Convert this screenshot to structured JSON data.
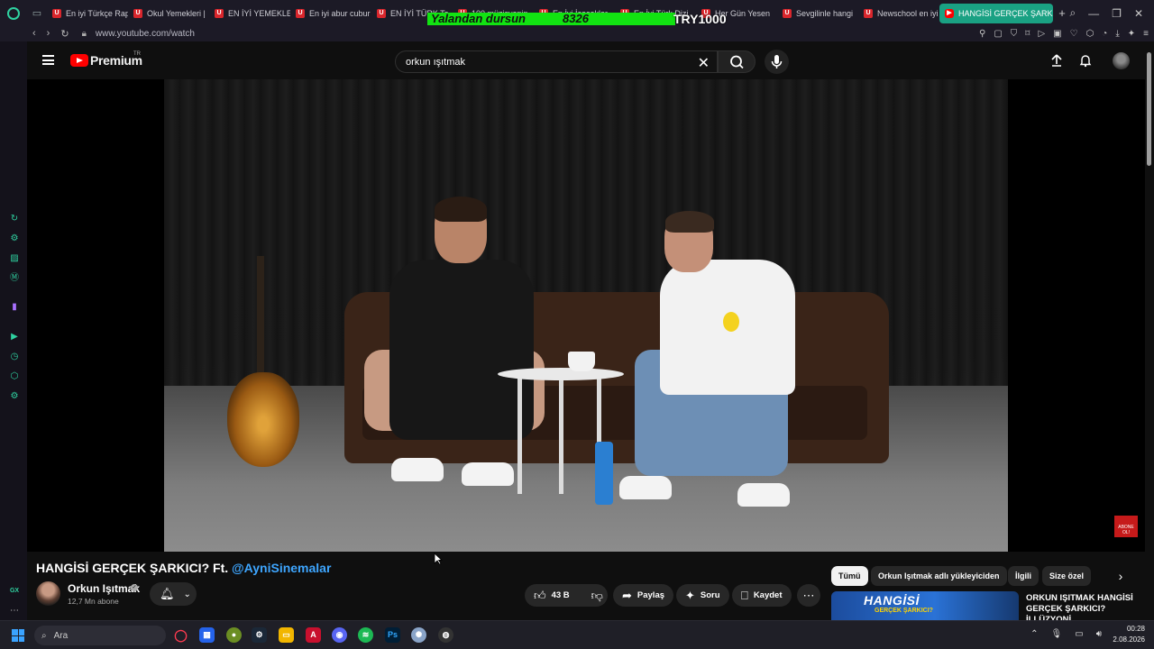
{
  "browser": {
    "tabs": [
      {
        "label": "En iyi Türkçe Rap"
      },
      {
        "label": "Okul Yemekleri |"
      },
      {
        "label": "EN İYİ YEMEKLER"
      },
      {
        "label": "En iyi abur cubur"
      },
      {
        "label": "EN İYİ TÜRK Ta"
      },
      {
        "label": "100 müzisyenin"
      },
      {
        "label": "En İyi İçecekler"
      },
      {
        "label": "En İyi Türk Dizi"
      },
      {
        "label": "Her Gün Yesen"
      },
      {
        "label": "Sevgilinle hangi"
      },
      {
        "label": "Newschool en iyi"
      },
      {
        "label": "HANGİSİ GERÇEK ŞARKICI"
      }
    ],
    "url": "www.youtube.com/watch",
    "sidebar_icons": [
      "refresh-icon",
      "bot-icon",
      "scan-icon",
      "m-icon",
      "twitch-icon",
      "play-icon",
      "clock-icon",
      "extensions-icon",
      "settings-icon",
      "gx-label",
      "more-icon"
    ],
    "gx_label": "GX"
  },
  "stream_overlay": {
    "left_text": "Yalandan dursun",
    "count": "8326",
    "right_text": "TRY1000"
  },
  "youtube": {
    "brand": "Premium",
    "region": "TR",
    "search_query": "orkun ışıtmak",
    "video": {
      "title_main": "HANGİSİ GERÇEK ŞARKICI? Ft. ",
      "title_mention": "@AyniSinemalar",
      "channel": "Orkun Işıtmak",
      "subscribers": "12,7 Mn abone",
      "likes": "43 B",
      "share_label": "Paylaş",
      "ask_label": "Soru",
      "save_label": "Kaydet"
    },
    "abone_badge": "ABONE OL!",
    "chips": [
      "Tümü",
      "Orkun Işıtmak adlı yükleyiciden",
      "İlgili",
      "Size özel"
    ],
    "recommended": {
      "thumb_text": "HANGİSİ",
      "thumb_sub": "GERÇEK ŞARKICI?",
      "title": "ORKUN IŞITMAK HANGİSİ GERÇEK ŞARKICI? İLLÜZYONİ"
    }
  },
  "taskbar": {
    "search_placeholder": "Ara",
    "time": "00:28",
    "date": "2.08.2026"
  },
  "colors": {
    "accent_green": "#1aa183",
    "youtube_red": "#ff0000",
    "mention_blue": "#3ea6ff",
    "overlay_green": "#12e312"
  }
}
